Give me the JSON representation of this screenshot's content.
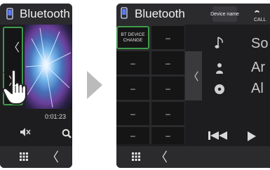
{
  "left_screen": {
    "title": "Bluetooth",
    "nav_prev_glyph": "〈",
    "nav_next_glyph": "〉",
    "elapsed_time": "0:01:23",
    "back_glyph": "〈",
    "icons": [
      "phone-icon",
      "mute-icon",
      "search-icon",
      "grid-menu-icon",
      "back-icon",
      "hand-pointer-icon"
    ]
  },
  "arrow": {
    "icon": "next-arrow-icon",
    "color": "#bbbbbb"
  },
  "right_screen": {
    "title": "Bluetooth",
    "device_name_button": "Device name",
    "call_label": "CALL",
    "bt_device_change_line1": "BT DEVICE",
    "bt_device_change_line2": "CHANGE",
    "pad_cells": [
      "–",
      "–",
      "–",
      "–",
      "–",
      "–",
      "–",
      "–",
      "–"
    ],
    "collapse_glyph": "〈",
    "song_text": "So",
    "artist_text": "Ar",
    "album_text": "Al",
    "back_glyph": "〈",
    "icons": [
      "phone-icon",
      "call-icon",
      "music-note-icon",
      "artist-icon",
      "album-icon",
      "previous-icon",
      "play-icon",
      "grid-menu-icon",
      "back-icon"
    ]
  },
  "colors": {
    "highlight": "#3f9a4a",
    "screen_bg": "#1d1d1f",
    "bar_bg": "#2b2b2e"
  }
}
